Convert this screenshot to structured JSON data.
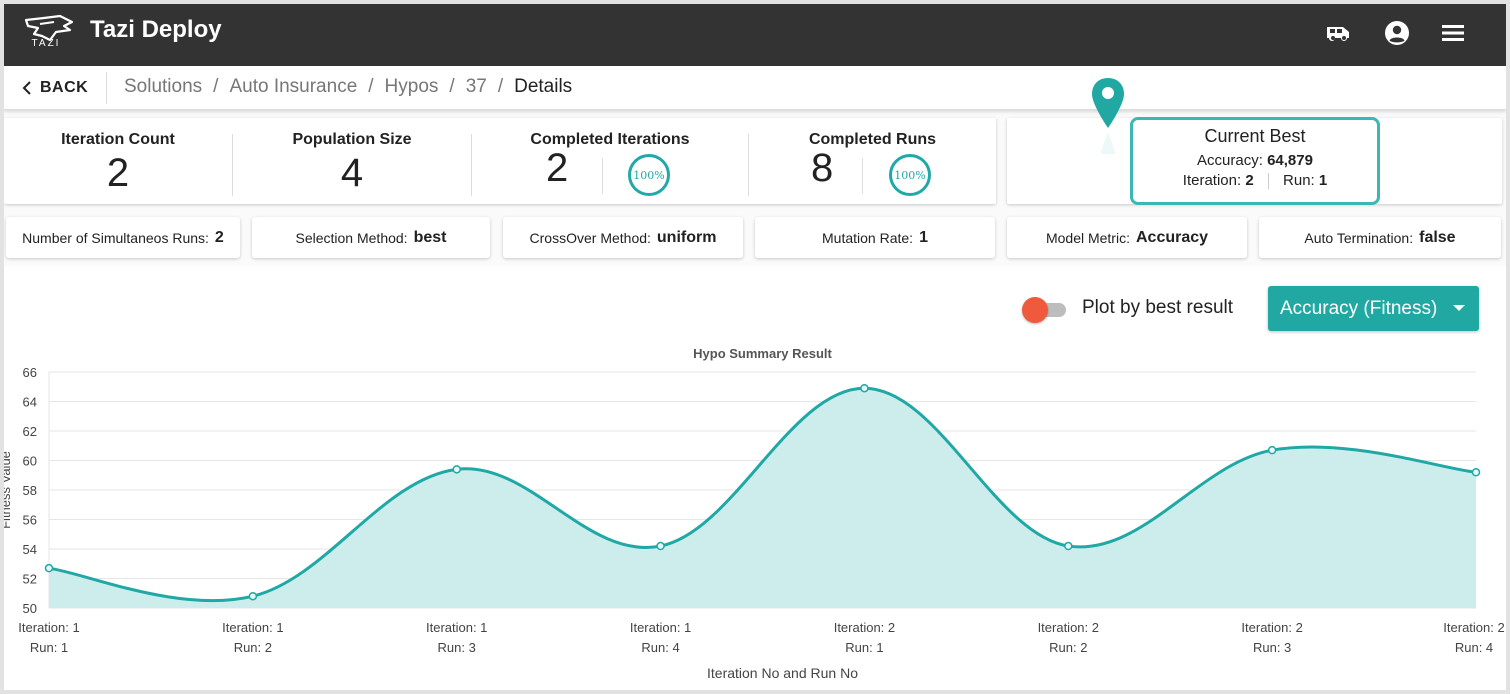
{
  "app": {
    "title": "Tazi Deploy",
    "logo_text": "TAZI"
  },
  "nav": {
    "back_label": "BACK",
    "breadcrumb": [
      "Solutions",
      "Auto Insurance",
      "Hypos",
      "37"
    ],
    "current": "Details"
  },
  "stats": {
    "iteration_count": {
      "label": "Iteration Count",
      "value": "2"
    },
    "population_size": {
      "label": "Population Size",
      "value": "4"
    },
    "completed_iterations": {
      "label": "Completed Iterations",
      "value": "2",
      "progress": "100%"
    },
    "completed_runs": {
      "label": "Completed Runs",
      "value": "8",
      "progress": "100%"
    }
  },
  "current_best": {
    "title": "Current Best",
    "accuracy_label": "Accuracy:",
    "accuracy_value": "64,879",
    "iteration_label": "Iteration:",
    "iteration_value": "2",
    "run_label": "Run:",
    "run_value": "1"
  },
  "params": [
    {
      "label": "Number of Simultaneos Runs:",
      "value": "2"
    },
    {
      "label": "Selection Method:",
      "value": "best"
    },
    {
      "label": "CrossOver Method:",
      "value": "uniform"
    },
    {
      "label": "Mutation Rate:",
      "value": "1"
    },
    {
      "label": "Model Metric:",
      "value": "Accuracy"
    },
    {
      "label": "Auto Termination:",
      "value": "false"
    }
  ],
  "controls": {
    "toggle_label": "Plot by best result",
    "metric_selected": "Accuracy (Fitness)"
  },
  "colors": {
    "accent": "#21a8a3",
    "toggle_thumb": "#ef5a3c",
    "topbar": "#333333"
  },
  "chart_data": {
    "type": "area",
    "title": "Hypo Summary Result",
    "xlabel": "Iteration No and Run No",
    "ylabel": "Fitness Value",
    "categories": [
      [
        "Iteration: 1",
        "Run: 1"
      ],
      [
        "Iteration: 1",
        "Run: 2"
      ],
      [
        "Iteration: 1",
        "Run: 3"
      ],
      [
        "Iteration: 1",
        "Run: 4"
      ],
      [
        "Iteration: 2",
        "Run: 1"
      ],
      [
        "Iteration: 2",
        "Run: 2"
      ],
      [
        "Iteration: 2",
        "Run: 3"
      ],
      [
        "Iteration: 2",
        "Run: 4"
      ]
    ],
    "values": [
      52.7,
      50.8,
      59.4,
      54.2,
      64.9,
      54.2,
      60.7,
      59.2
    ],
    "ylim": [
      50,
      66
    ],
    "yticks": [
      50,
      52,
      54,
      56,
      58,
      60,
      62,
      64,
      66
    ],
    "grid": true,
    "smooth": true,
    "line_color": "#1fa8a5",
    "fill_color": "#cdeded"
  }
}
